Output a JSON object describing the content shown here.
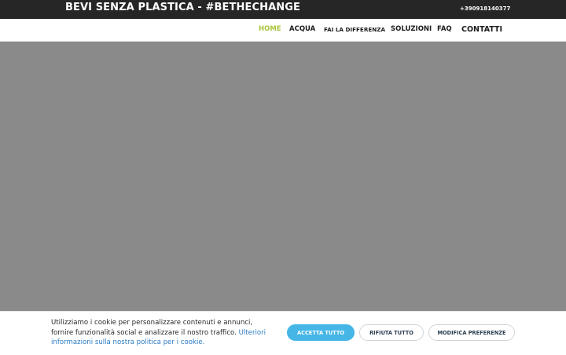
{
  "header": {
    "brand": "BEVI SENZA PLASTICA - #BETHECHANGE",
    "phone": "+390918140377"
  },
  "nav": {
    "items": [
      {
        "label": "HOME",
        "active": true
      },
      {
        "label": "ACQUA",
        "active": false
      },
      {
        "label": "FAI LA DIFFERENZA",
        "active": false
      },
      {
        "label": "SOLUZIONI",
        "active": false
      },
      {
        "label": "FAQ",
        "active": false
      },
      {
        "label": "CONTATTI",
        "active": false
      }
    ]
  },
  "cookie_banner": {
    "text": "Utilizziamo i cookie per personalizzare contenuti e annunci, fornire funzionalità social e analizzare il nostro traffico.",
    "link_text": "Ulteriori informazioni sulla nostra politica per i cookie.",
    "accept_label": "ACCETTA TUTTO",
    "reject_label": "RIFIUTA TUTTO",
    "modify_label": "MODIFICA PREFERENZE"
  },
  "colors": {
    "topbar": "#262626",
    "active_nav": "#a8c43c",
    "hero": "#8a8a8a",
    "accept_button": "#45b6e6",
    "link": "#2a7bc4"
  }
}
